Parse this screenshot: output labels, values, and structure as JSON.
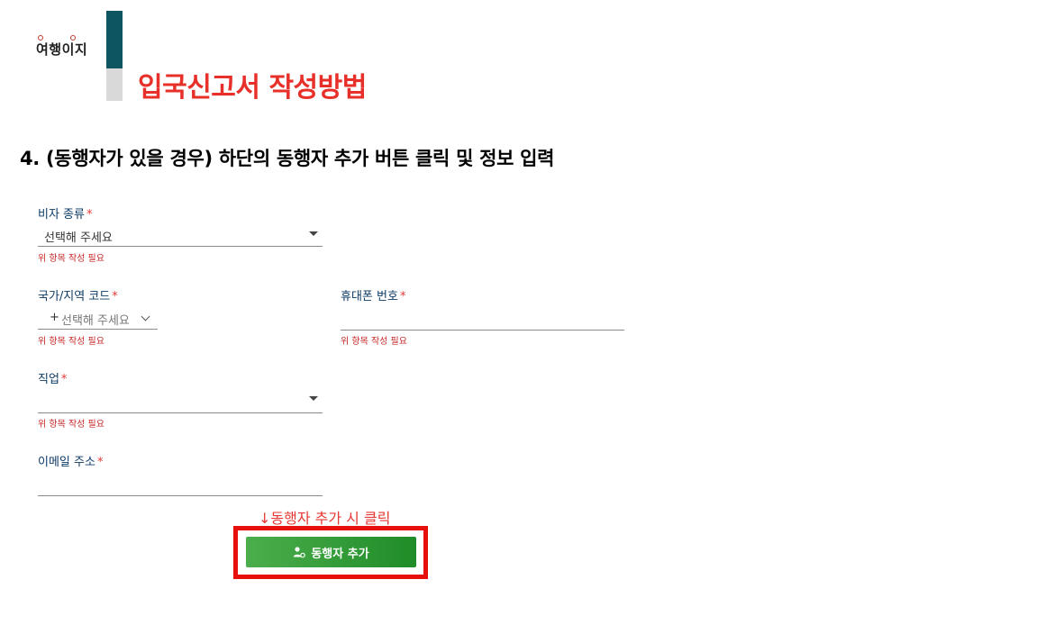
{
  "header": {
    "logo_text": "여행이지",
    "title": "입국신고서 작성방법"
  },
  "step": {
    "heading": "4. (동행자가 있을 경우) 하단의 동행자 추가 버튼 클릭 및 정보 입력"
  },
  "form": {
    "required_mark": "*",
    "visa_type": {
      "label": "비자 종류",
      "value": "선택해 주세요",
      "error": "위 항목 작성 필요"
    },
    "country_code": {
      "label": "국가/지역 코드",
      "plus": "+",
      "placeholder": "선택해 주세요",
      "error": "위 항목 작성 필요"
    },
    "phone": {
      "label": "휴대폰 번호",
      "value": "",
      "error": "위 항목 작성 필요"
    },
    "job": {
      "label": "직업",
      "value": "",
      "error": "위 항목 작성 필요"
    },
    "email": {
      "label": "이메일 주소",
      "value": ""
    }
  },
  "annotation": {
    "hint": "↓동행자 추가 시 클릭",
    "highlight_color": "#e8100d"
  },
  "add_companion_button": {
    "label": "동행자 추가",
    "icon": "person-add-icon"
  }
}
